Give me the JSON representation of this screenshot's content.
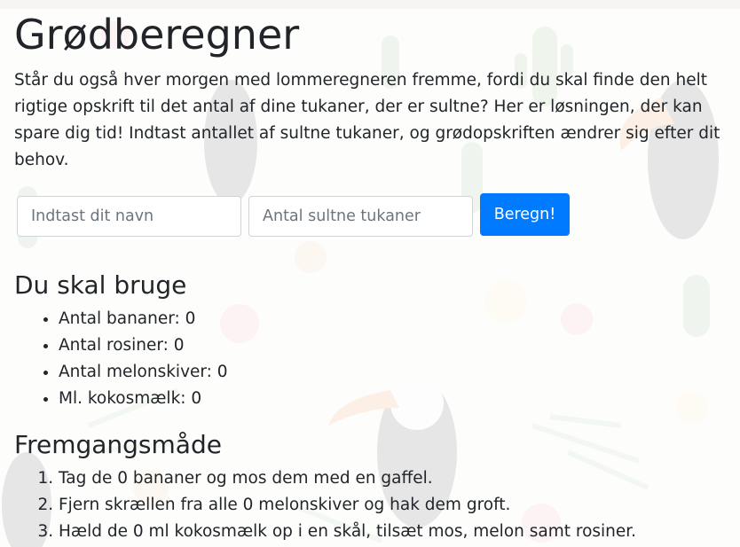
{
  "page": {
    "title": "Grødberegner",
    "intro": "Står du også hver morgen med lommeregneren fremme, fordi du skal finde den helt rigtige opskrift til det antal af dine tukaner, der er sultne? Her er løsningen, der kan spare dig tid! Indtast antallet af sultne tukaner, og grødopskriften ændrer sig efter dit behov."
  },
  "form": {
    "name_placeholder": "Indtast dit navn",
    "name_value": "",
    "count_placeholder": "Antal sultne tukaner",
    "count_value": "",
    "submit_label": "Beregn!",
    "accent_color": "#007bff"
  },
  "ingredients": {
    "heading": "Du skal bruge",
    "items": [
      "Antal bananer: 0",
      "Antal rosiner: 0",
      "Antal melonskiver: 0",
      "Ml. kokosmælk: 0"
    ]
  },
  "method": {
    "heading": "Fremgangsmåde",
    "steps": [
      "Tag de 0 bananer og mos dem med en gaffel.",
      "Fjern skrællen fra alle 0 melonskiver og hak dem groft.",
      "Hæld de 0 ml kokosmælk op i en skål, tilsæt mos, melon samt rosiner."
    ]
  },
  "background": {
    "description_icons": [
      "toucan-icon",
      "cactus-icon",
      "hibiscus-icon",
      "palm-leaf-icon"
    ]
  }
}
